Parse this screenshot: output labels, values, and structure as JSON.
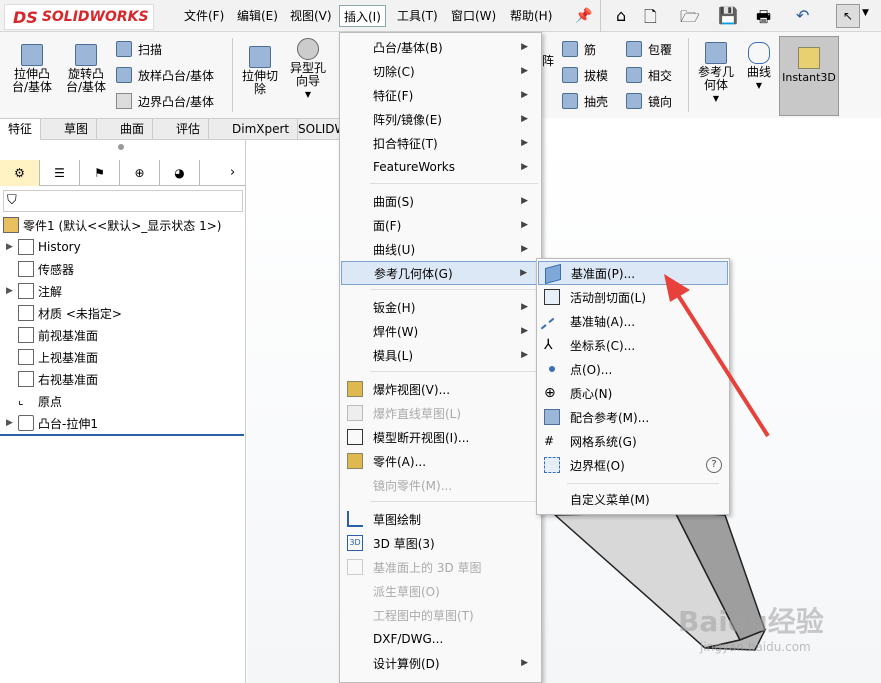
{
  "app": {
    "logo": "SOLIDWORKS"
  },
  "menubar": {
    "items": [
      "文件(F)",
      "编辑(E)",
      "视图(V)",
      "插入(I)",
      "工具(T)",
      "窗口(W)",
      "帮助(H)"
    ]
  },
  "ribbon": {
    "extrude_boss": "拉伸凸\n台/基体",
    "revolve_boss": "旋转凸\n台/基体",
    "sweep": "扫描",
    "loft": "放样凸台/基体",
    "boundary": "边界凸台/基体",
    "extrude_cut": "拉伸切\n除",
    "hole_wizard": "异型孔\n向导",
    "pattern": "阵",
    "rib": "筋",
    "wrap": "包覆",
    "draft": "拔模",
    "intersect": "相交",
    "shell": "抽壳",
    "mirror": "镜向",
    "ref_geom": "参考几\n何体",
    "curves": "曲线",
    "instant3d": "Instant3D"
  },
  "tabs": [
    "特征",
    "草图",
    "曲面",
    "评估",
    "DimXpert",
    "SOLIDW"
  ],
  "tree": {
    "root": "零件1 (默认<<默认>_显示状态 1>)",
    "items": [
      "History",
      "传感器",
      "注解",
      "材质 <未指定>",
      "前视基准面",
      "上视基准面",
      "右视基准面",
      "原点",
      "凸台-拉伸1"
    ]
  },
  "insert_menu": {
    "items": [
      "凸台/基体(B)",
      "切除(C)",
      "特征(F)",
      "阵列/镜像(E)",
      "扣合特征(T)",
      "FeatureWorks",
      "曲面(S)",
      "面(F)",
      "曲线(U)",
      "参考几何体(G)",
      "钣金(H)",
      "焊件(W)",
      "模具(L)",
      "爆炸视图(V)...",
      "爆炸直线草图(L)",
      "模型断开视图(I)...",
      "零件(A)...",
      "镜向零件(M)...",
      "草图绘制",
      "3D 草图(3)",
      "基准面上的 3D 草图",
      "派生草图(O)",
      "工程图中的草图(T)",
      "DXF/DWG...",
      "设计算例(D)"
    ]
  },
  "refgeom_menu": {
    "items": [
      "基准面(P)...",
      "活动剖切面(L)",
      "基准轴(A)...",
      "坐标系(C)...",
      "点(O)...",
      "质心(N)",
      "配合参考(M)...",
      "网格系统(G)",
      "边界框(O)",
      "自定义菜单(M)"
    ]
  },
  "watermark": {
    "brand": "Baidu经验",
    "url": "jingyan.baidu.com"
  },
  "colors": {
    "accent": "#d8262b",
    "highlight": "#dde8f6",
    "arrow": "#e8403a"
  }
}
